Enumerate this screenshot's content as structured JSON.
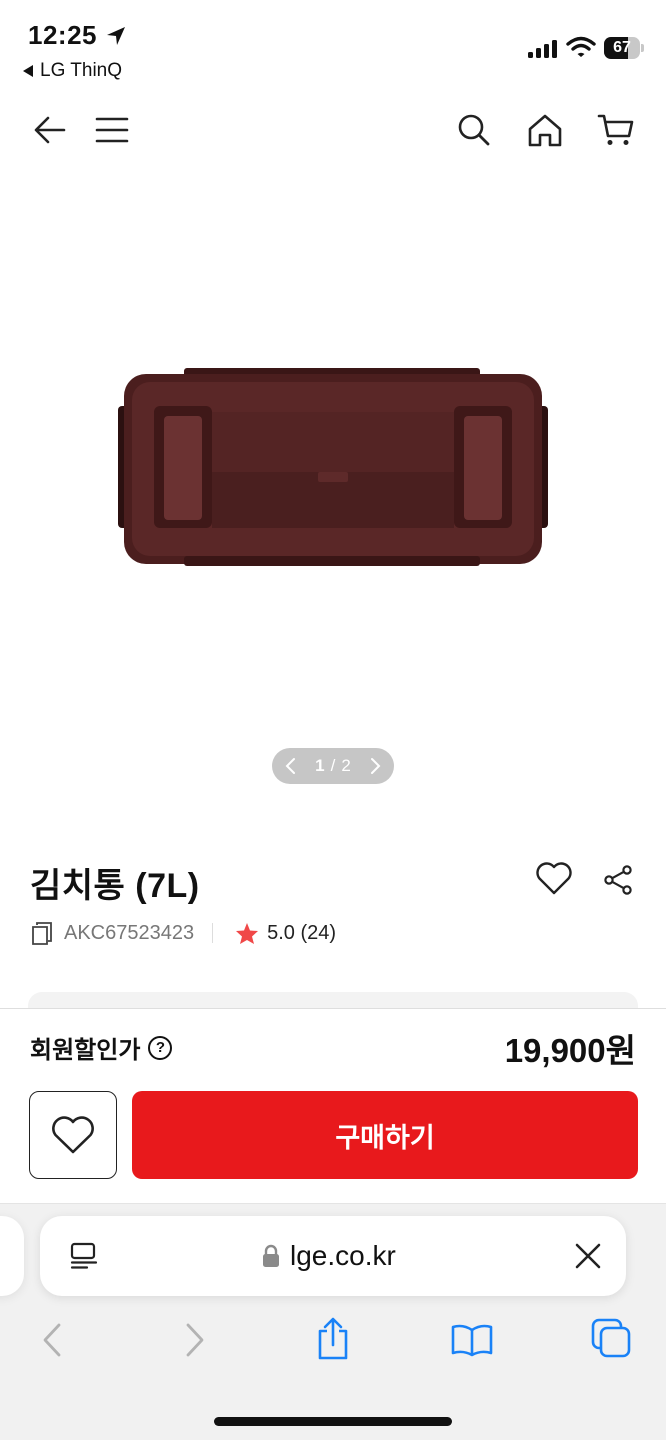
{
  "status_bar": {
    "time": "12:25",
    "back_app": "LG ThinQ",
    "battery": "67",
    "battery_level": 0.67
  },
  "product": {
    "title": "김치통 (7L)",
    "model_code": "AKC67523423",
    "rating_text": "5.0 (24)",
    "image_pager": {
      "current": "1",
      "separator": "/",
      "total": "2"
    }
  },
  "purchase": {
    "price_label": "회원할인가",
    "help_glyph": "?",
    "price": "19,900원",
    "buy_label": "구매하기"
  },
  "browser": {
    "url": "lge.co.kr"
  },
  "colors": {
    "accent_red": "#e8191c",
    "star_red": "#f04848",
    "link_blue": "#1a82f7",
    "product_brown": "#4b1e1e"
  },
  "icons": {
    "header": [
      "back-arrow-icon",
      "menu-icon",
      "search-icon",
      "home-icon",
      "cart-icon"
    ],
    "product": [
      "heart-icon",
      "share-icon",
      "copy-icon",
      "star-icon"
    ],
    "safari": [
      "reader-icon",
      "lock-icon",
      "close-icon",
      "back-chevron-icon",
      "forward-chevron-icon",
      "share-up-icon",
      "bookmarks-icon",
      "tabs-icon"
    ]
  }
}
